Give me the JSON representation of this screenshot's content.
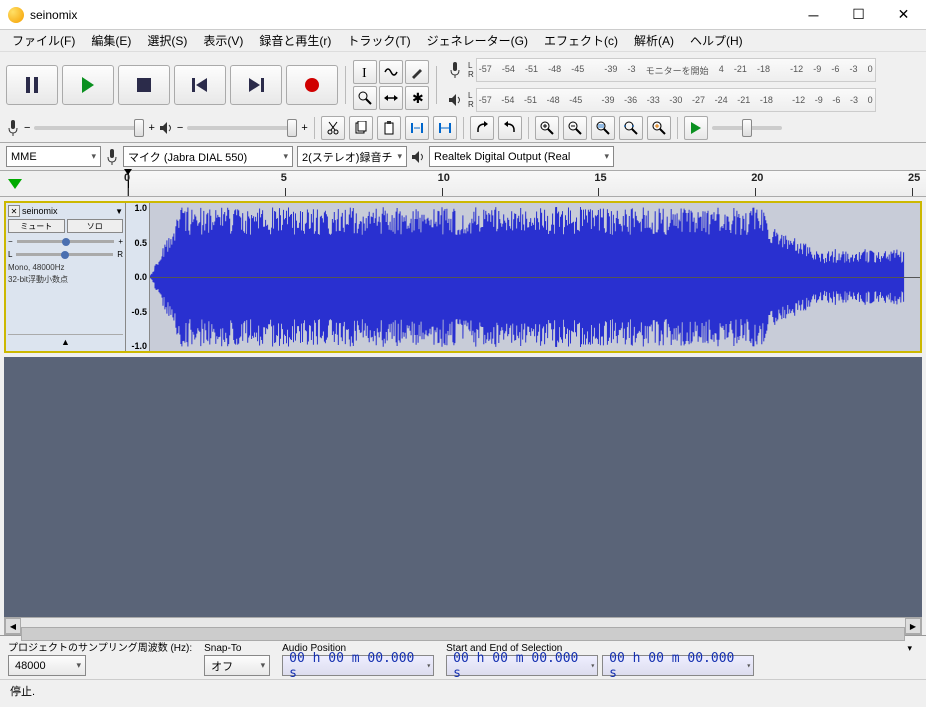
{
  "window": {
    "title": "seinomix"
  },
  "menu": {
    "file": "ファイル(F)",
    "edit": "編集(E)",
    "select": "選択(S)",
    "view": "表示(V)",
    "transport": "録音と再生(r)",
    "tracks": "トラック(T)",
    "generate": "ジェネレーター(G)",
    "effect": "エフェクト(c)",
    "analyze": "解析(A)",
    "help": "ヘルプ(H)"
  },
  "meters": {
    "ticks_rec": [
      "-57",
      "-54",
      "-51",
      "-48",
      "-45",
      "",
      "-39",
      "-3",
      "モニターを開始",
      "4",
      "-21",
      "-18",
      "",
      "-12",
      "-9",
      "-6",
      "-3",
      "0"
    ],
    "ticks_play": [
      "-57",
      "-54",
      "-51",
      "-48",
      "-45",
      "",
      "-39",
      "-36",
      "-33",
      "-30",
      "-27",
      "-24",
      "-21",
      "-18",
      "",
      "-12",
      "-9",
      "-6",
      "-3",
      "0"
    ],
    "hint": "モニターを開始"
  },
  "devices": {
    "host": "MME",
    "input": "マイク (Jabra DIAL 550)",
    "channels": "2(ステレオ)録音チ",
    "output": "Realtek Digital Output (Real"
  },
  "ruler": {
    "labels": [
      "0",
      "5",
      "10",
      "15",
      "20",
      "25"
    ]
  },
  "track": {
    "name": "seinomix",
    "mute": "ミュート",
    "solo": "ソロ",
    "pan_left": "L",
    "pan_right": "R",
    "gain_minus": "−",
    "gain_plus": "+",
    "info1": "Mono, 48000Hz",
    "info2": "32-bit浮動小数点",
    "scale": [
      "1.0",
      "0.5",
      "0.0",
      "-0.5",
      "-1.0"
    ]
  },
  "footer": {
    "rate_label": "プロジェクトのサンプリング周波数 (Hz):",
    "rate_value": "48000",
    "snap_label": "Snap-To",
    "snap_value": "オフ",
    "audiopos_label": "Audio Position",
    "audiopos_value": "00 h 00 m 00.000 s",
    "selection_label": "Start and End of Selection",
    "sel_start": "00 h 00 m 00.000 s",
    "sel_end": "00 h 00 m 00.000 s"
  },
  "status": {
    "text": "停止."
  }
}
